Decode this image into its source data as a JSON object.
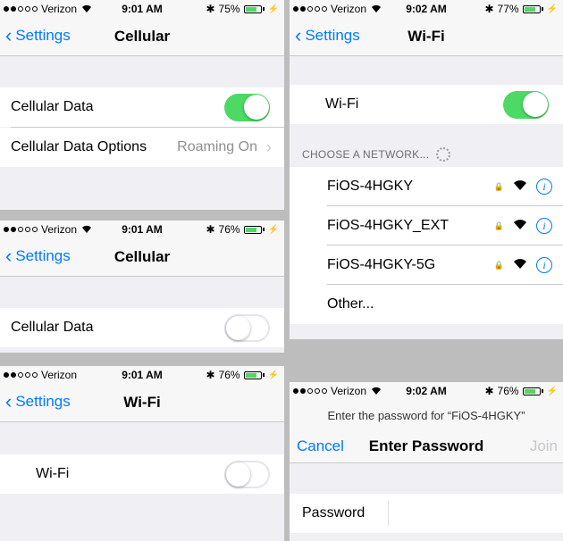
{
  "colors": {
    "accent": "#007aff",
    "toggle_on": "#4cd964",
    "background": "#efeff4"
  },
  "carrier": "Verizon",
  "panel1": {
    "time": "9:01 AM",
    "battery": "75%",
    "battery_level": 0.75,
    "back": "Settings",
    "title": "Cellular",
    "cellular_data_label": "Cellular Data",
    "cellular_data_on": true,
    "options_label": "Cellular Data Options",
    "options_value": "Roaming On"
  },
  "panel2": {
    "time": "9:01 AM",
    "battery": "76%",
    "battery_level": 0.76,
    "back": "Settings",
    "title": "Cellular",
    "cellular_data_label": "Cellular Data",
    "cellular_data_on": false
  },
  "panel3": {
    "time": "9:01 AM",
    "battery": "76%",
    "battery_level": 0.76,
    "back": "Settings",
    "title": "Wi-Fi",
    "wifi_label": "Wi-Fi",
    "wifi_on": false
  },
  "panel4": {
    "time": "9:02 AM",
    "battery": "77%",
    "battery_level": 0.77,
    "back": "Settings",
    "title": "Wi-Fi",
    "wifi_label": "Wi-Fi",
    "wifi_on": true,
    "section_header": "CHOOSE A NETWORK...",
    "networks": [
      "FiOS-4HGKY",
      "FiOS-4HGKY_EXT",
      "FiOS-4HGKY-5G"
    ],
    "other": "Other..."
  },
  "panel5": {
    "time": "9:02 AM",
    "battery": "76%",
    "battery_level": 0.76,
    "prompt": "Enter the password for “FiOS-4HGKY”",
    "cancel": "Cancel",
    "title": "Enter Password",
    "join": "Join",
    "password_label": "Password"
  }
}
